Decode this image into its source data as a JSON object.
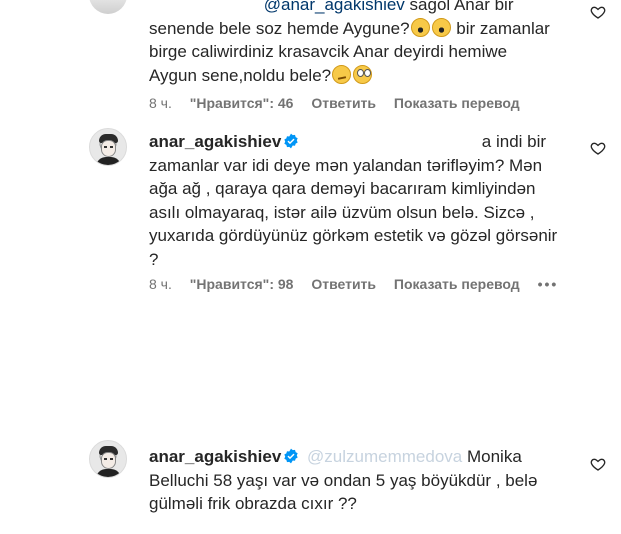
{
  "comments": [
    {
      "id": "c1",
      "mention": "@anar_agakishiev",
      "text_first": "sagol Anar bir",
      "lines": [
        "senende bele soz hemde Aygune?",
        "bir zamanlar",
        "birge caliwirdiniz krasavcik Anar deyirdi hemiwe",
        "Aygun sene,noldu bele?"
      ],
      "emojis": [
        "scream-face-emoji",
        "scream-face-emoji",
        "thinking-face-emoji",
        "eye-roll-face-emoji"
      ],
      "time": "8 ч.",
      "likes": "\"Нравится\": 46",
      "reply": "Ответить",
      "translate": "Показать перевод"
    },
    {
      "id": "c2",
      "username": "anar_agakishiev",
      "text_first": "a indi bir",
      "lines": [
        "zamanlar var idi deye mən yalandan tərifləyim? Mən",
        "ağa ağ , qaraya qara deməyi bacarıram kimliyindən",
        "asılı olmayaraq, istər ailə üzvüm olsun belə. Sizcə ,",
        "yuxarıda gördüyünüz görkəm estetik və gözəl görsənir",
        "?"
      ],
      "time": "8 ч.",
      "likes": "\"Нравится\": 98",
      "reply": "Ответить",
      "translate": "Показать перевод",
      "more": "•••"
    },
    {
      "id": "c3",
      "username": "anar_agakishiev",
      "mention": "@zulzumemmedova",
      "text_first": "Monika",
      "lines": [
        "Belluchi 58 yaşı var və ondan 5 yaş böyükdür , belə",
        "gülməli frik obrazda cıxır ??"
      ]
    }
  ],
  "colors": {
    "text": "#262626",
    "meta": "#737373",
    "mention": "#00376b",
    "verified": "#0095f6"
  },
  "icons": {
    "like": "heart-outline-icon",
    "verified": "verified-badge-icon",
    "more": "more-options-icon"
  }
}
